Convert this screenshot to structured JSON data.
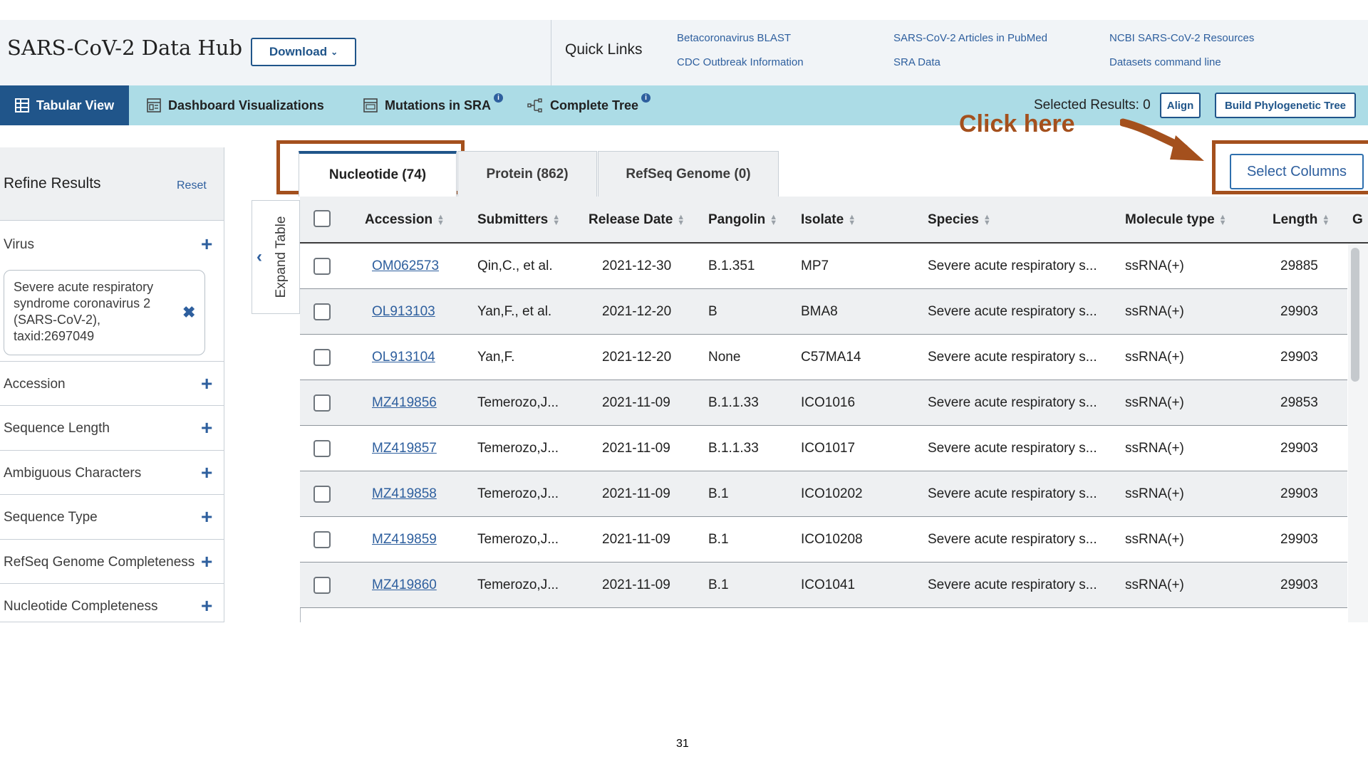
{
  "header": {
    "app_title": "SARS-CoV-2 Data Hub",
    "download_label": "Download",
    "quick_links_label": "Quick Links",
    "quick_links": [
      "Betacoronavirus BLAST",
      "CDC Outbreak Information",
      "SARS-CoV-2 Articles in PubMed",
      "SRA Data",
      "NCBI SARS-CoV-2 Resources",
      "Datasets command line"
    ]
  },
  "nav": {
    "tabs": [
      "Tabular View",
      "Dashboard Visualizations",
      "Mutations in SRA",
      "Complete Tree"
    ],
    "info_glyph": "i",
    "selected_results": "Selected Results: 0",
    "align_label": "Align",
    "build_tree_label": "Build Phylogenetic Tree"
  },
  "annotation": {
    "text": "Click here",
    "color": "#a4501d"
  },
  "sidebar": {
    "title": "Refine Results",
    "reset_label": "Reset",
    "facets": [
      "Virus",
      "Accession",
      "Sequence Length",
      "Ambiguous Characters",
      "Sequence Type",
      "RefSeq Genome Completeness",
      "Nucleotide Completeness"
    ],
    "virus_filter": "Severe acute respiratory syndrome coronavirus 2 (SARS-CoV-2), taxid:2697049",
    "plus_glyph": "+",
    "remove_glyph": "✖"
  },
  "expand_table_label": "Expand Table",
  "result_tabs": [
    "Nucleotide (74)",
    "Protein (862)",
    "RefSeq Genome (0)"
  ],
  "select_columns_label": "Select Columns",
  "table": {
    "columns": [
      "Accession",
      "Submitters",
      "Release Date",
      "Pangolin",
      "Isolate",
      "Species",
      "Molecule type",
      "Length",
      "G"
    ],
    "rows": [
      [
        "OM062573",
        "Qin,C., et al.",
        "2021-12-30",
        "B.1.351",
        "MP7",
        "Severe acute respiratory s...",
        "ssRNA(+)",
        "29885"
      ],
      [
        "OL913103",
        "Yan,F., et al.",
        "2021-12-20",
        "B",
        "BMA8",
        "Severe acute respiratory s...",
        "ssRNA(+)",
        "29903"
      ],
      [
        "OL913104",
        "Yan,F.",
        "2021-12-20",
        "None",
        "C57MA14",
        "Severe acute respiratory s...",
        "ssRNA(+)",
        "29903"
      ],
      [
        "MZ419856",
        "Temerozo,J...",
        "2021-11-09",
        "B.1.1.33",
        "ICO1016",
        "Severe acute respiratory s...",
        "ssRNA(+)",
        "29853"
      ],
      [
        "MZ419857",
        "Temerozo,J...",
        "2021-11-09",
        "B.1.1.33",
        "ICO1017",
        "Severe acute respiratory s...",
        "ssRNA(+)",
        "29903"
      ],
      [
        "MZ419858",
        "Temerozo,J...",
        "2021-11-09",
        "B.1",
        "ICO10202",
        "Severe acute respiratory s...",
        "ssRNA(+)",
        "29903"
      ],
      [
        "MZ419859",
        "Temerozo,J...",
        "2021-11-09",
        "B.1",
        "ICO10208",
        "Severe acute respiratory s...",
        "ssRNA(+)",
        "29903"
      ],
      [
        "MZ419860",
        "Temerozo,J...",
        "2021-11-09",
        "B.1",
        "ICO1041",
        "Severe acute respiratory s...",
        "ssRNA(+)",
        "29903"
      ]
    ]
  },
  "page_number": "31",
  "colors": {
    "brand_blue": "#20558a",
    "nav_bg": "#acdce6",
    "link_blue": "#2e5f9e",
    "annotation_brown": "#a4501d"
  }
}
